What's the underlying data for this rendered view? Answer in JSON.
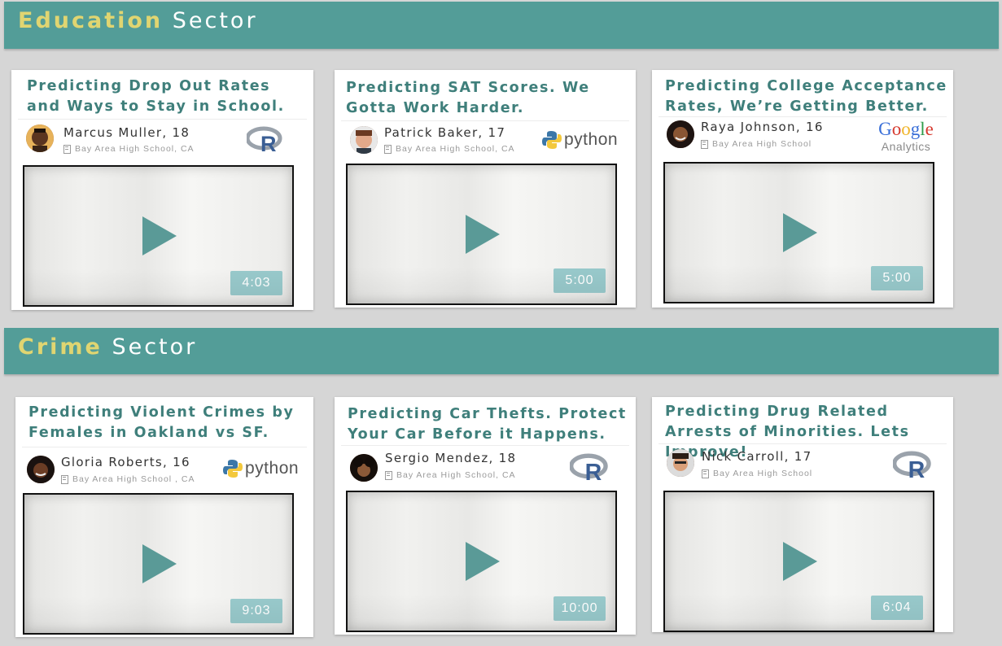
{
  "sectors": [
    {
      "highlight": "Education",
      "rest": "Sector"
    },
    {
      "highlight": "Crime",
      "rest": "Sector"
    }
  ],
  "cards": [
    {
      "title": "Predicting Drop Out Rates and Ways to Stay in School.",
      "author": "Marcus Muller, 18",
      "school": "Bay Area High School, CA",
      "tool": "r-logo",
      "duration": "4:03"
    },
    {
      "title": "Predicting SAT Scores. We Gotta Work Harder.",
      "author": "Patrick Baker, 17",
      "school": "Bay Area High School, CA",
      "tool": "python-logo",
      "tool_text": "python",
      "duration": "5:00"
    },
    {
      "title": "Predicting College Acceptance Rates, We’re Getting Better.",
      "author": "Raya Johnson, 16",
      "school": "Bay Area High School",
      "tool": "google-analytics-logo",
      "tool_text": "Google",
      "tool_subtext": "Analytics",
      "duration": "5:00"
    },
    {
      "title": "Predicting Violent Crimes by Females in Oakland vs SF.",
      "author": "Gloria Roberts, 16",
      "school": "Bay Area High School , CA",
      "tool": "python-logo",
      "tool_text": "python",
      "duration": "9:03"
    },
    {
      "title": "Predicting Car Thefts. Protect Your Car Before it Happens.",
      "author": "Sergio Mendez, 18",
      "school": "Bay Area High School, CA",
      "tool": "r-logo",
      "duration": "10:00"
    },
    {
      "title": "Predicting Drug Related Arrests of Minorities. Lets Improve!",
      "author": "Nick Carroll, 17",
      "school": "Bay Area High School",
      "tool": "r-logo",
      "duration": "6:04"
    }
  ],
  "colors": {
    "band": "#539d98",
    "highlight": "#e0d571",
    "title": "#3f7f7b",
    "duration_bg": "#98c9cb",
    "play": "#5a9a97"
  }
}
